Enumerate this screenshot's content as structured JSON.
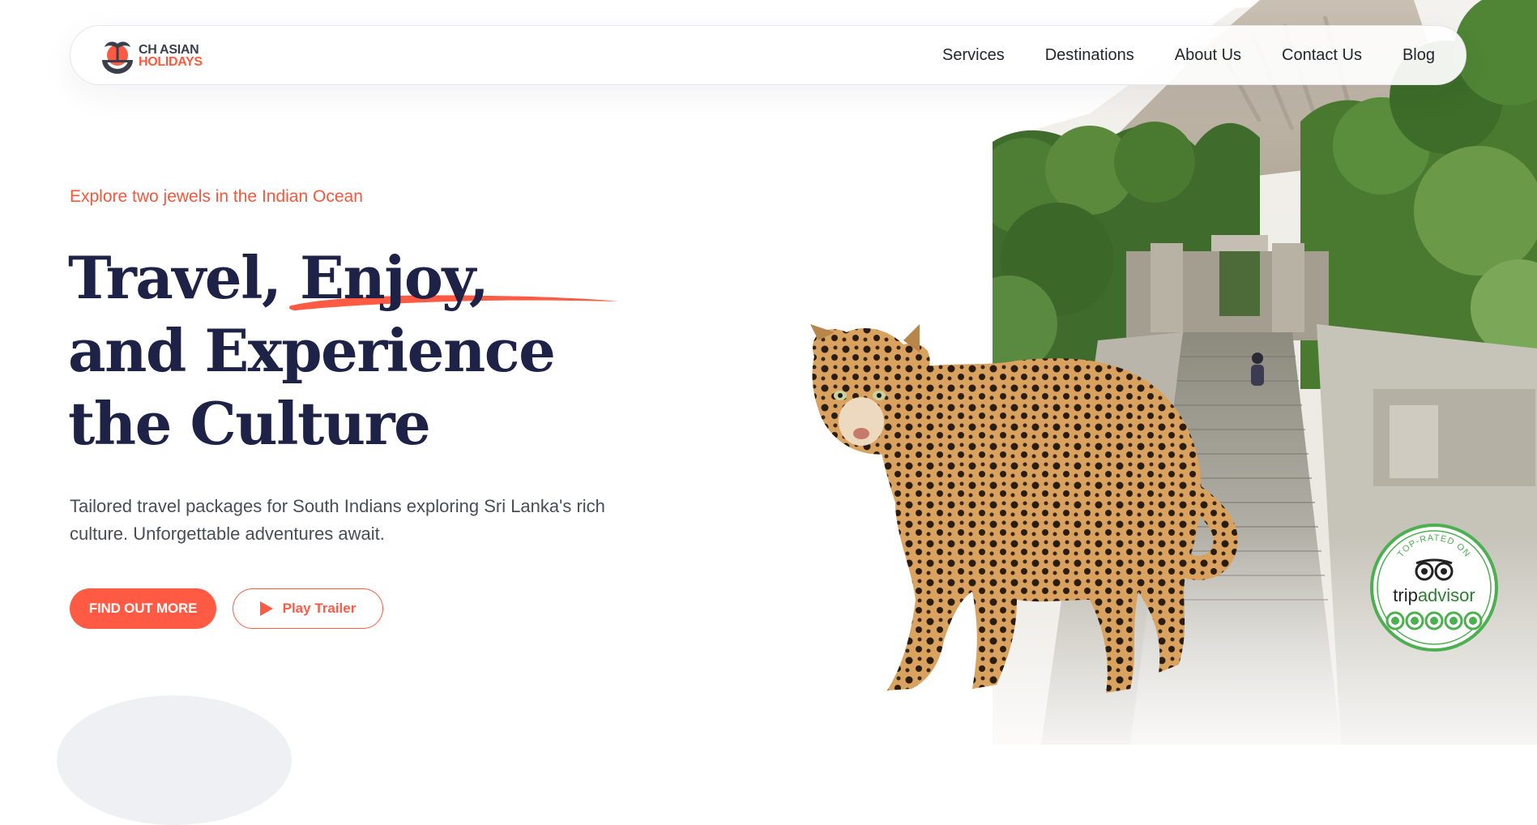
{
  "brand": {
    "logo_line1": "CH ASIAN",
    "logo_line2": "HOLIDAYS"
  },
  "nav": {
    "items": [
      {
        "label": "Services"
      },
      {
        "label": "Destinations"
      },
      {
        "label": "About Us"
      },
      {
        "label": "Contact Us"
      },
      {
        "label": "Blog"
      }
    ]
  },
  "hero": {
    "kicker": "Explore two jewels in the Indian Ocean",
    "headline_lines": [
      "Travel, Enjoy,",
      "and Experience",
      "the Culture"
    ],
    "subtext": "Tailored travel packages for South Indians exploring Sri Lanka's rich culture. Unforgettable adventures await.",
    "primary_button": "FIND OUT MORE",
    "secondary_button": "Play Trailer"
  },
  "badge": {
    "top_text": "TOP-RATED ON",
    "brand_prefix": "trip",
    "brand_suffix": "advisor",
    "rating_circles": 5
  },
  "colors": {
    "accent": "#ff5a43",
    "heading": "#1e2247",
    "tripadvisor_green": "#4caf50"
  },
  "icons": [
    "palm-sun-logo-icon",
    "play-icon",
    "owl-eyes-icon"
  ]
}
